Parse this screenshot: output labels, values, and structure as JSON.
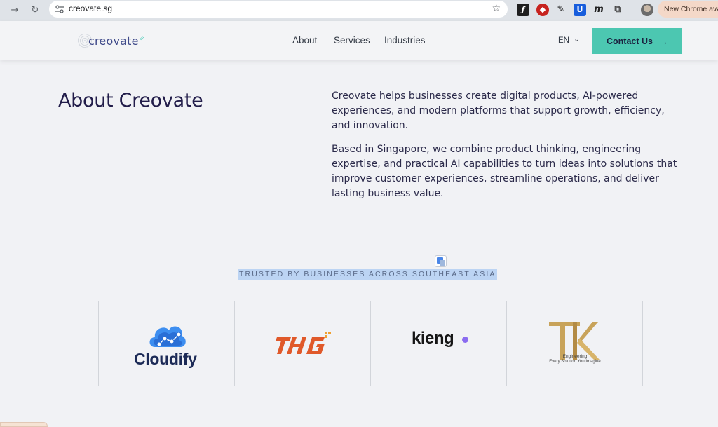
{
  "browser": {
    "url": "creovate.sg",
    "new_chrome_label": "New Chrome ava",
    "extensions": [
      "fontsninja-icon",
      "ublock-icon",
      "eyedropper-icon",
      "bitwarden-icon",
      "m-icon",
      "puzzle-icon"
    ]
  },
  "header": {
    "logo_text": "creovate",
    "nav": [
      "About",
      "Services",
      "Industries"
    ],
    "lang": "EN",
    "contact_label": "Contact Us"
  },
  "about": {
    "title": "About Creovate",
    "paragraph1": "Creovate helps businesses create digital products, AI-powered experiences, and modern platforms that support growth, efficiency, and innovation.",
    "paragraph2": "Based in Singapore, we combine product thinking, engineering expertise, and practical AI capabilities to turn ideas into solutions that improve customer experiences, streamline operations, and deliver lasting business value."
  },
  "trusted": {
    "label": "TRUSTED BY BUSINESSES ACROSS SOUTHEAST ASIA"
  },
  "logos": {
    "cloudify": "Cloudify",
    "kieng": "kieng",
    "tk_line1": "Engineering",
    "tk_line2": "Every Solution You Imagine"
  },
  "colors": {
    "accent": "#4cc7b1",
    "heading": "#221d4a",
    "highlight": "#bcd4f3"
  }
}
